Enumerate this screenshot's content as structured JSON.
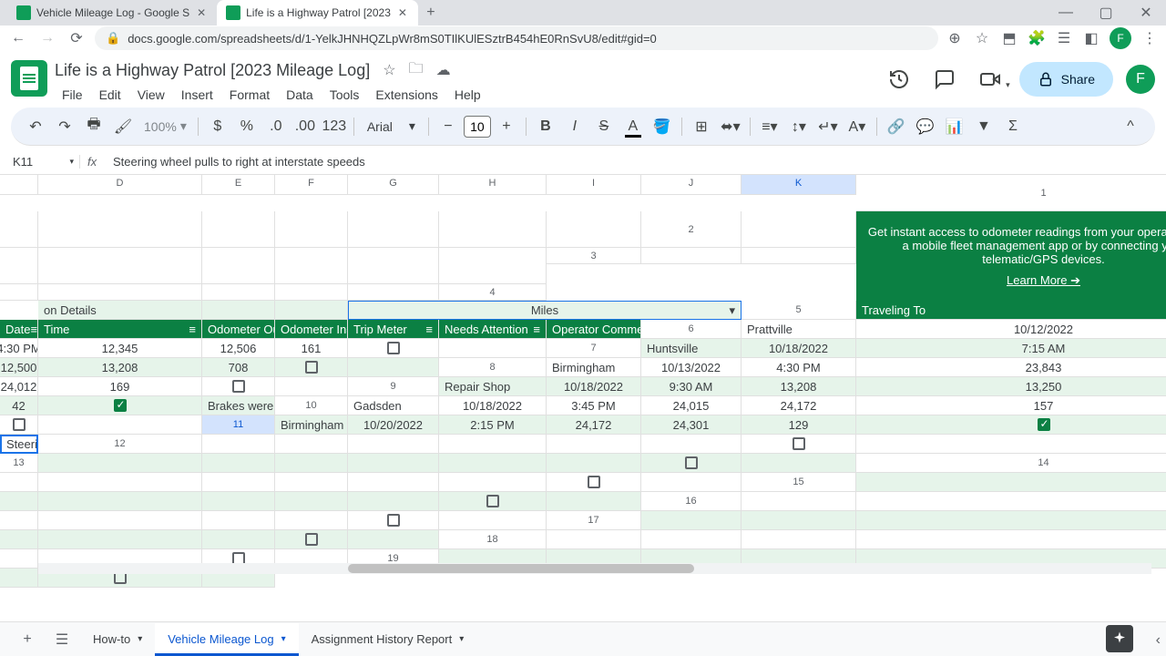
{
  "browser": {
    "tabs": [
      {
        "title": "Vehicle Mileage Log - Google S",
        "active": false
      },
      {
        "title": "Life is a Highway Patrol [2023",
        "active": true
      }
    ],
    "url": "docs.google.com/spreadsheets/d/1-YelkJHNHQZLpWr8mS0TIlKUlESztrB454hE0RnSvU8/edit#gid=0",
    "profile_initial": "F"
  },
  "doc": {
    "title": "Life is a Highway Patrol [2023 Mileage Log]",
    "menus": [
      "File",
      "Edit",
      "View",
      "Insert",
      "Format",
      "Data",
      "Tools",
      "Extensions",
      "Help"
    ],
    "share_label": "Share",
    "avatar_initial": "F"
  },
  "toolbar": {
    "zoom": "100%",
    "number_label": "123",
    "font": "Arial",
    "font_size": "10"
  },
  "formula": {
    "name_box": "K11",
    "value": "Steering wheel pulls to right at interstate speeds"
  },
  "grid": {
    "columns": [
      "D",
      "E",
      "F",
      "G",
      "H",
      "I",
      "J",
      "K"
    ],
    "banner_text": "Get instant access to odometer readings from your operators using a mobile fleet management app or by connecting your telematic/GPS devices.",
    "banner_link": "Learn More ➔",
    "section_labels": {
      "dest": "on Details",
      "miles": "Miles"
    },
    "headers": [
      "Traveling To",
      "Date",
      "Time",
      "Odometer Out",
      "Odometer In",
      "Trip Meter",
      "Needs Attention",
      "Operator Comments"
    ],
    "rows": [
      {
        "n": 6,
        "to": "Prattville",
        "date": "10/12/2022",
        "time": "4:30 PM",
        "out": "12,345",
        "in": "12,506",
        "trip": "161",
        "attn": false,
        "comment": ""
      },
      {
        "n": 7,
        "to": "Huntsville",
        "date": "10/18/2022",
        "time": "7:15 AM",
        "out": "12,500",
        "in": "13,208",
        "trip": "708",
        "attn": false,
        "comment": ""
      },
      {
        "n": 8,
        "to": "Birmingham",
        "date": "10/13/2022",
        "time": "4:30 PM",
        "out": "23,843",
        "in": "24,012",
        "trip": "169",
        "attn": false,
        "comment": ""
      },
      {
        "n": 9,
        "to": "Repair Shop",
        "date": "10/18/2022",
        "time": "9:30 AM",
        "out": "13,208",
        "in": "13,250",
        "trip": "42",
        "attn": true,
        "comment": "Brakes were squealing on interstate. Took to shop for inspection."
      },
      {
        "n": 10,
        "to": "Gadsden",
        "date": "10/18/2022",
        "time": "3:45 PM",
        "out": "24,015",
        "in": "24,172",
        "trip": "157",
        "attn": false,
        "comment": ""
      },
      {
        "n": 11,
        "to": "Birmingham",
        "date": "10/20/2022",
        "time": "2:15 PM",
        "out": "24,172",
        "in": "24,301",
        "trip": "129",
        "attn": true,
        "comment": "Steering wheel pulls to right at interstate speeds"
      }
    ],
    "empty_rows": [
      12,
      13,
      14,
      15,
      16,
      17,
      18,
      19
    ]
  },
  "sheets": {
    "tabs": [
      {
        "name": "How-to",
        "active": false
      },
      {
        "name": "Vehicle Mileage Log",
        "active": true
      },
      {
        "name": "Assignment History Report",
        "active": false
      }
    ]
  }
}
